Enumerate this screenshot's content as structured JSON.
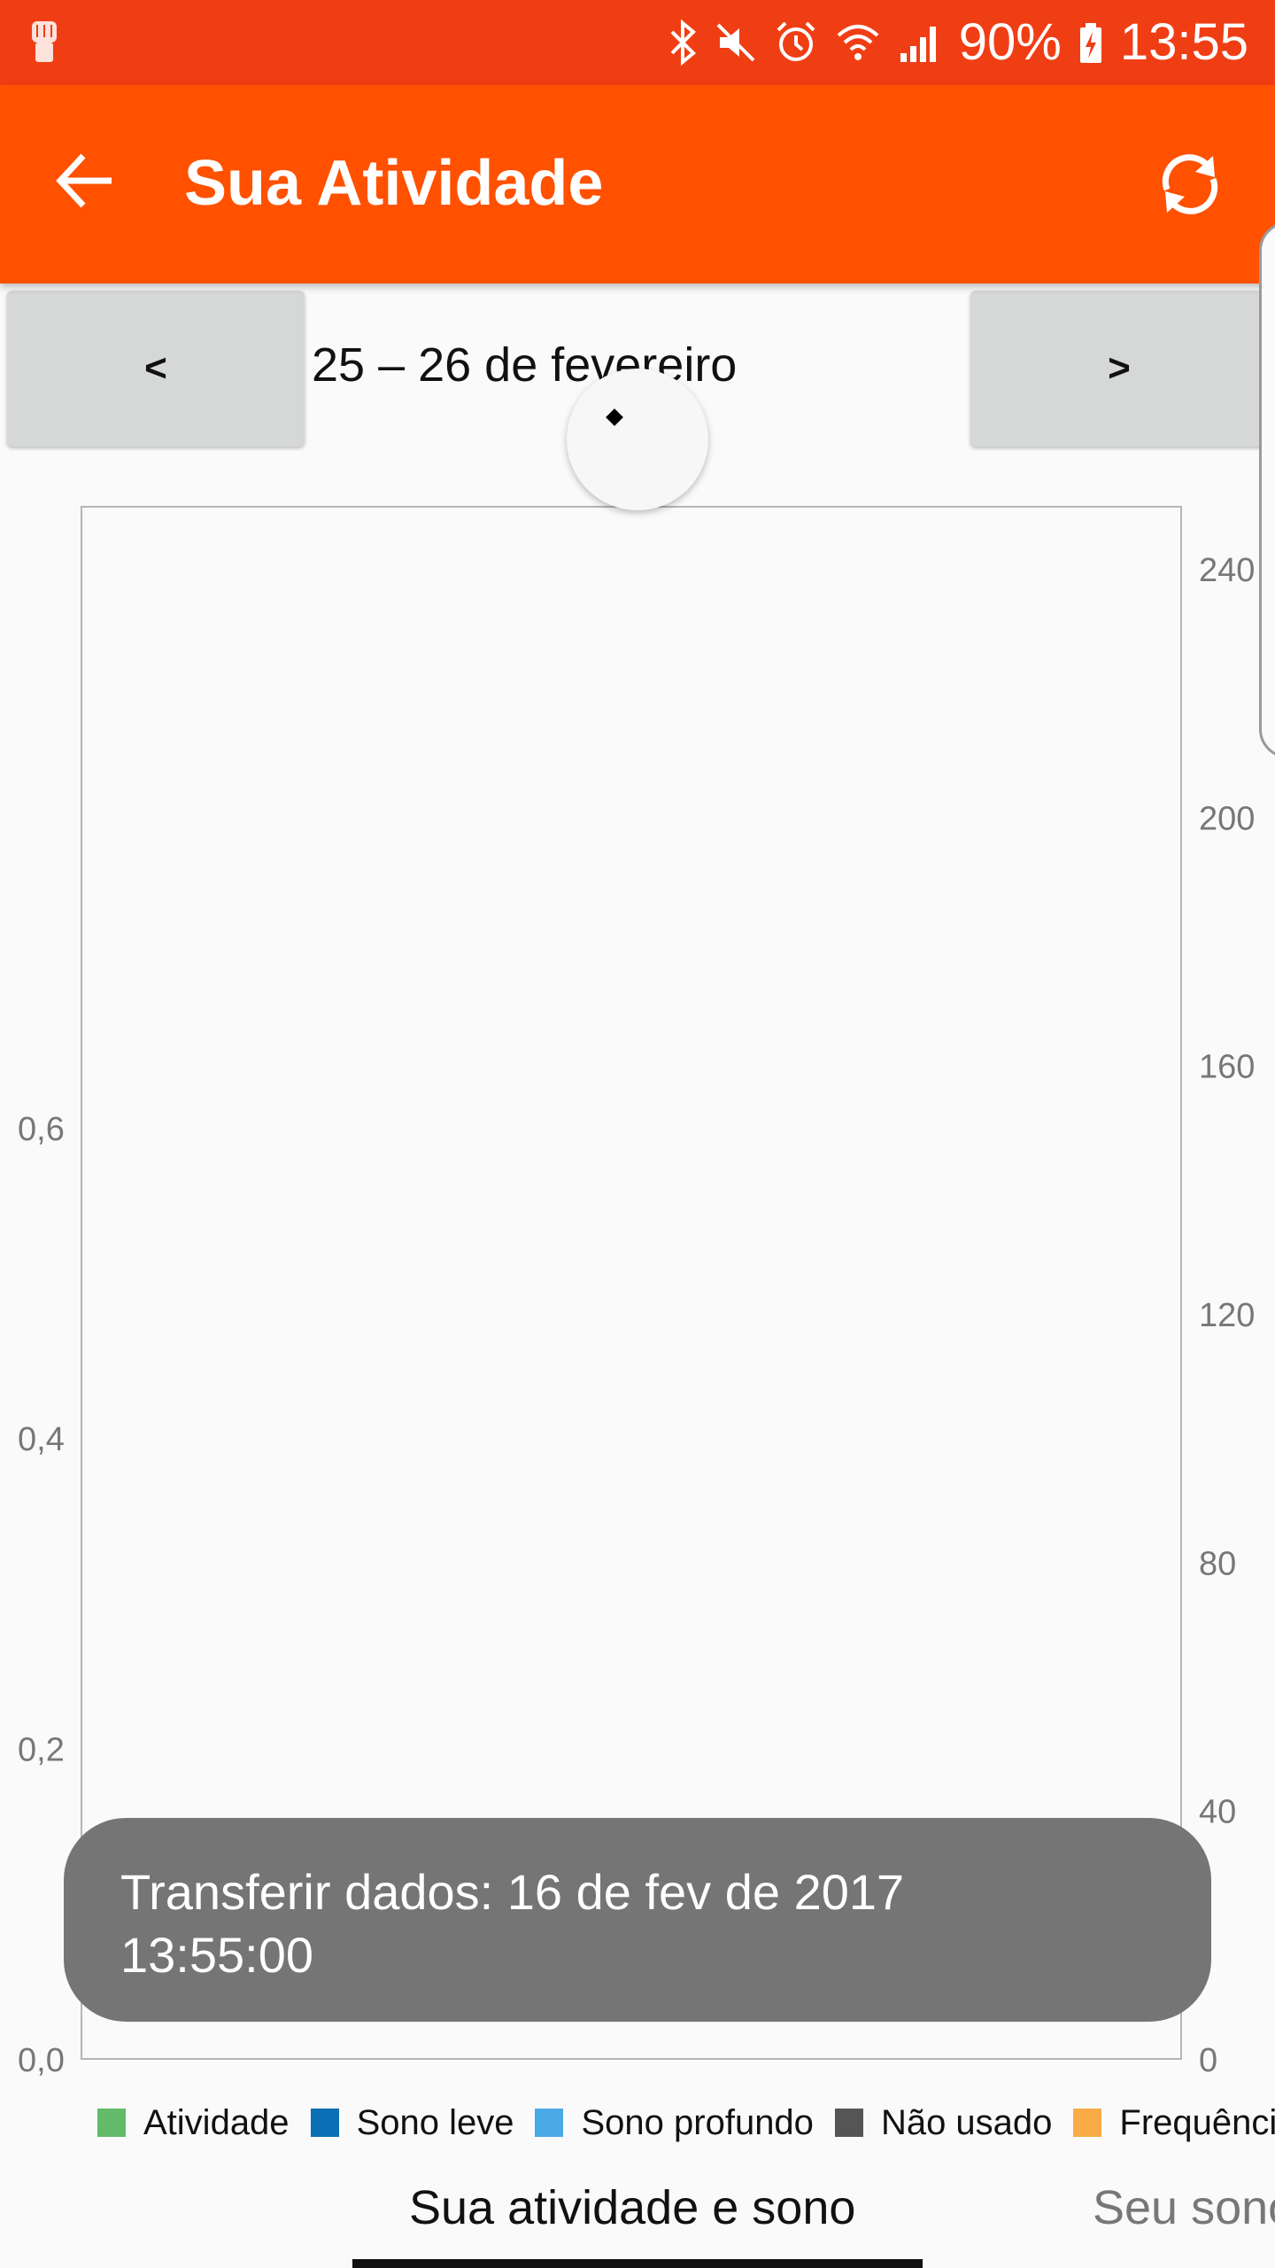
{
  "status_bar": {
    "battery": "90%",
    "time": "13:55"
  },
  "app_bar": {
    "title": "Sua Atividade",
    "back_icon": "arrow-back-icon",
    "sync_icon": "sync-icon"
  },
  "date_nav": {
    "prev_label": "<",
    "next_label": ">",
    "date_range": "25 – 26 de fevereiro"
  },
  "chart_data": {
    "type": "bar",
    "left_axis": {
      "ticks": [
        "0,0",
        "0,2",
        "0,4",
        "0,6"
      ],
      "ylim": [
        0,
        1.0
      ]
    },
    "right_axis": {
      "ticks": [
        "0",
        "40",
        "80",
        "120",
        "160",
        "200",
        "240"
      ],
      "ylim": [
        0,
        250
      ]
    },
    "series": [],
    "legend": [
      {
        "label": "Atividade",
        "color": "#62bb6a"
      },
      {
        "label": "Sono leve",
        "color": "#0b6fb5"
      },
      {
        "label": "Sono profundo",
        "color": "#4aaae6"
      },
      {
        "label": "Não usado",
        "color": "#555555"
      },
      {
        "label": "Frequência",
        "color": "#f9ab45"
      }
    ],
    "legend_position": "bottom"
  },
  "toast": {
    "text": "Transferir dados: 16 de fev de 2017\n13:55:00"
  },
  "tabs": [
    {
      "label": "Sua atividade e sono",
      "active": true
    },
    {
      "label": "Seu sono",
      "active": false
    }
  ]
}
